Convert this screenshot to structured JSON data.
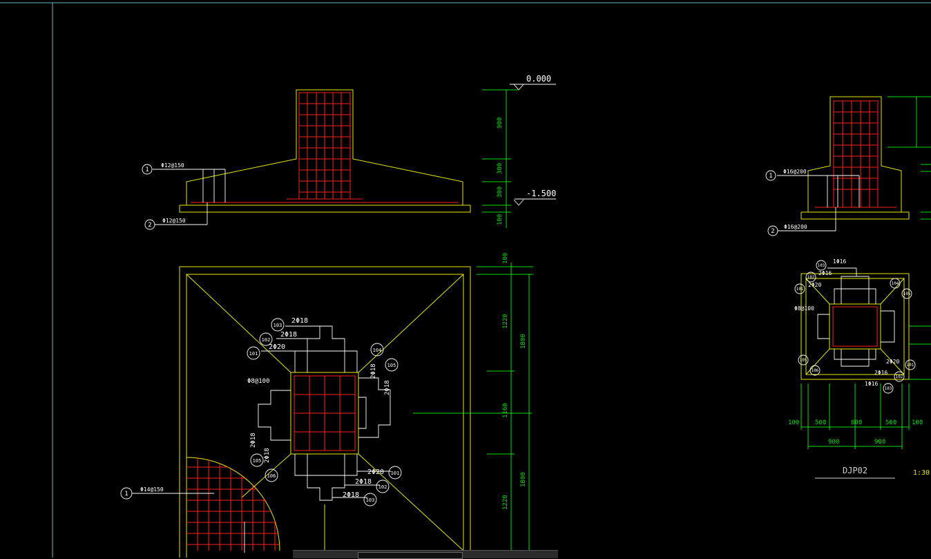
{
  "drawing": {
    "labels": {
      "elev_top": "0.000",
      "elev_bottom": "-1.500",
      "sec1_rebar1": "Φ12@150",
      "sec1_rebar2": "Φ12@150",
      "mark1": "1",
      "mark2": "2",
      "dim_900": "900",
      "dim_300a": "300",
      "dim_300b": "300",
      "dim_100a": "100",
      "dim_100b": "100",
      "dim_1220a": "1220",
      "dim_1220b": "1220",
      "dim_1800a": "1800",
      "dim_1800b": "1800",
      "dim_1160": "1160",
      "plan_2d18_a": "2Φ18",
      "plan_2d18_b": "2Φ18",
      "plan_2d20_a": "2Φ20",
      "plan_2d18_c": "2Φ18",
      "plan_2d18_d": "2Φ18",
      "plan_2d18_e": "2Φ18",
      "plan_2d18_f": "2Φ18",
      "plan_2d20_b": "2Φ20",
      "plan_2d18_g": "2Φ18",
      "plan_2d18_h": "2Φ18",
      "plan_phi8": "Φ8@100",
      "plan_phi14": "Φ14@150",
      "tag_101": "101",
      "tag_102": "102",
      "tag_103": "103",
      "tag_104": "104",
      "tag_105": "105",
      "tag_106": "106",
      "r_sec_rebar1": "Φ16@200",
      "r_sec_rebar2": "Φ16@200",
      "r_1d16a": "1Φ16",
      "r_2d16": "2Φ16",
      "r_2d20a": "2Φ20",
      "r_phi8": "Φ8@100",
      "r_2d20b": "2Φ20",
      "r_2d16b": "2Φ16",
      "r_1d16b": "1Φ16",
      "r_dim_100a": "100",
      "r_dim_500a": "500",
      "r_dim_800": "800",
      "r_dim_500b": "500",
      "r_dim_100b": "100",
      "r_dim_900a": "900",
      "r_dim_900b": "900",
      "r_title": "DJP02",
      "r_scale": "1:30"
    }
  },
  "colors": {
    "background": "#000000",
    "outline": "#e8e800",
    "rebar": "#ff2020",
    "dimension": "#00e000",
    "annotation": "#ffffff"
  }
}
